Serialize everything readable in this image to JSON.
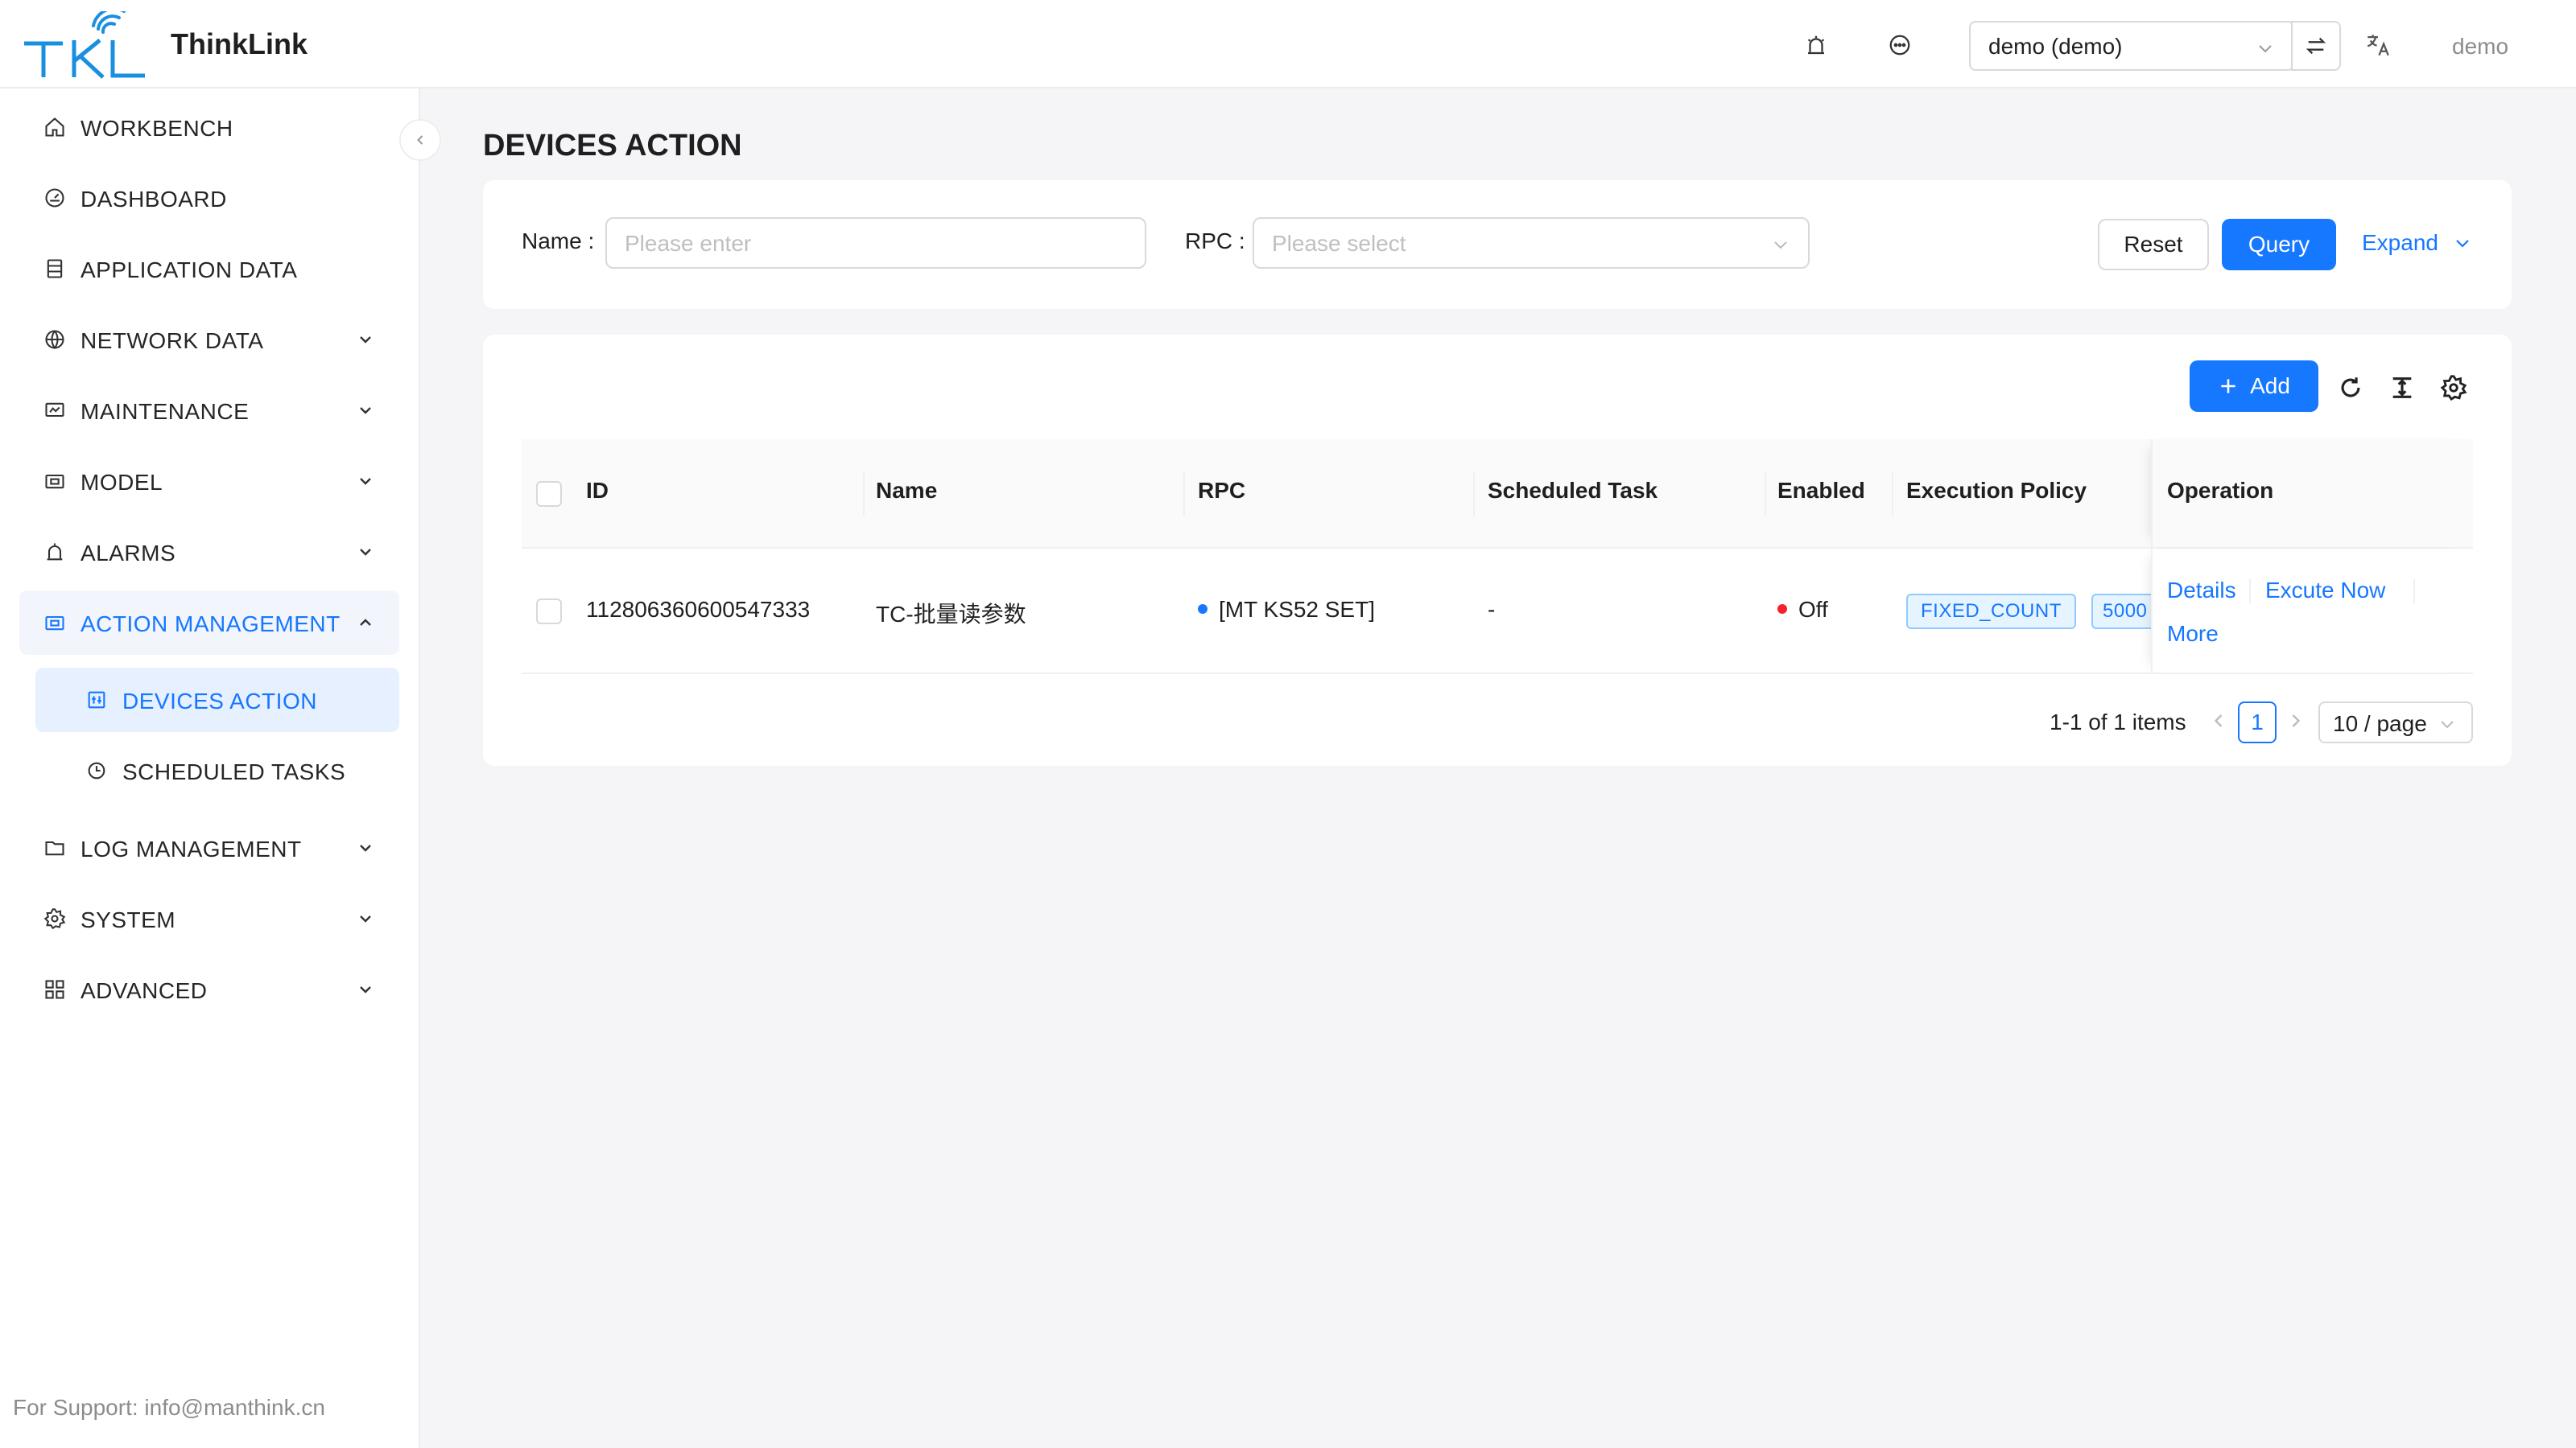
{
  "header": {
    "app_title": "ThinkLink",
    "logo_text": "TKL",
    "tenant_value": "demo (demo)",
    "user_name": "demo",
    "icons": [
      "alarm-light-icon",
      "chat-icon",
      "swap-icon",
      "translate-icon"
    ]
  },
  "sidebar": {
    "items": [
      {
        "label": "WORKBENCH",
        "icon": "home-icon"
      },
      {
        "label": "DASHBOARD",
        "icon": "dashboard-icon"
      },
      {
        "label": "APPLICATION DATA",
        "icon": "database-icon"
      },
      {
        "label": "NETWORK DATA",
        "icon": "globe-icon"
      },
      {
        "label": "MAINTENANCE",
        "icon": "maintenance-icon"
      },
      {
        "label": "MODEL",
        "icon": "model-icon"
      },
      {
        "label": "ALARMS",
        "icon": "alarm-icon"
      },
      {
        "label": "ACTION MANAGEMENT",
        "icon": "action-icon"
      },
      {
        "label": "LOG MANAGEMENT",
        "icon": "folder-icon"
      },
      {
        "label": "SYSTEM",
        "icon": "gear-icon"
      },
      {
        "label": "ADVANCED",
        "icon": "grid-icon"
      }
    ],
    "sub_items": [
      {
        "label": "DEVICES ACTION",
        "icon": "devices-action-icon"
      },
      {
        "label": "SCHEDULED TASKS",
        "icon": "clock-icon"
      }
    ],
    "support": "For Support: info@manthink.cn"
  },
  "page": {
    "title": "DEVICES ACTION"
  },
  "search": {
    "name_label": "Name",
    "name_placeholder": "Please enter",
    "rpc_label": "RPC",
    "rpc_placeholder": "Please select",
    "reset_label": "Reset",
    "query_label": "Query",
    "expand_label": "Expand"
  },
  "table": {
    "add_label": "Add",
    "columns": [
      "ID",
      "Name",
      "RPC",
      "Scheduled Task",
      "Enabled",
      "Execution Policy",
      "Operation"
    ],
    "rows": [
      {
        "id": "112806360600547333",
        "name": "TC-批量读参数",
        "rpc": "[MT KS52 SET]",
        "scheduled_task": "-",
        "enabled": "Off",
        "policy_tag": "FIXED_COUNT",
        "policy_tag2": "5000",
        "ops": {
          "details": "Details",
          "execute": "Excute Now",
          "more": "More"
        }
      }
    ],
    "colors": {
      "rpc_dot": "#1677ff",
      "off_dot": "#f5222d",
      "accent": "#1677ff"
    }
  },
  "pagination": {
    "summary": "1-1 of 1 items",
    "current_page": "1",
    "page_size": "10 / page"
  }
}
